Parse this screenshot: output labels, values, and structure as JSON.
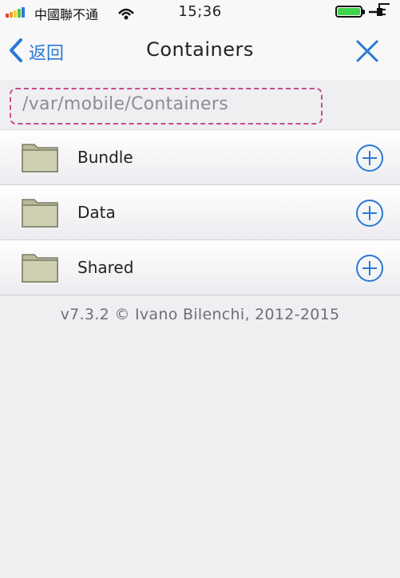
{
  "status_bar": {
    "carrier": "中國聯不通",
    "time": "15;36",
    "signal_colors": [
      "#e33b2e",
      "#f09a2a",
      "#f1d22c",
      "#4fc34b",
      "#2a78d6"
    ],
    "battery_color": "#3fd44b"
  },
  "nav": {
    "back_label": "返回",
    "title": "Containers",
    "back_icon": "chevron-left-icon",
    "close_icon": "close-icon",
    "accent": "#2a78d6"
  },
  "path": {
    "value": "/var/mobile/Containers"
  },
  "items": [
    {
      "label": "Bundle",
      "icon": "folder-icon",
      "action_icon": "add-circle-icon"
    },
    {
      "label": "Data",
      "icon": "folder-icon",
      "action_icon": "add-circle-icon"
    },
    {
      "label": "Shared",
      "icon": "folder-icon",
      "action_icon": "add-circle-icon"
    }
  ],
  "footer": {
    "text": "v7.3.2 © Ivano Bilenchi, 2012-2015"
  }
}
